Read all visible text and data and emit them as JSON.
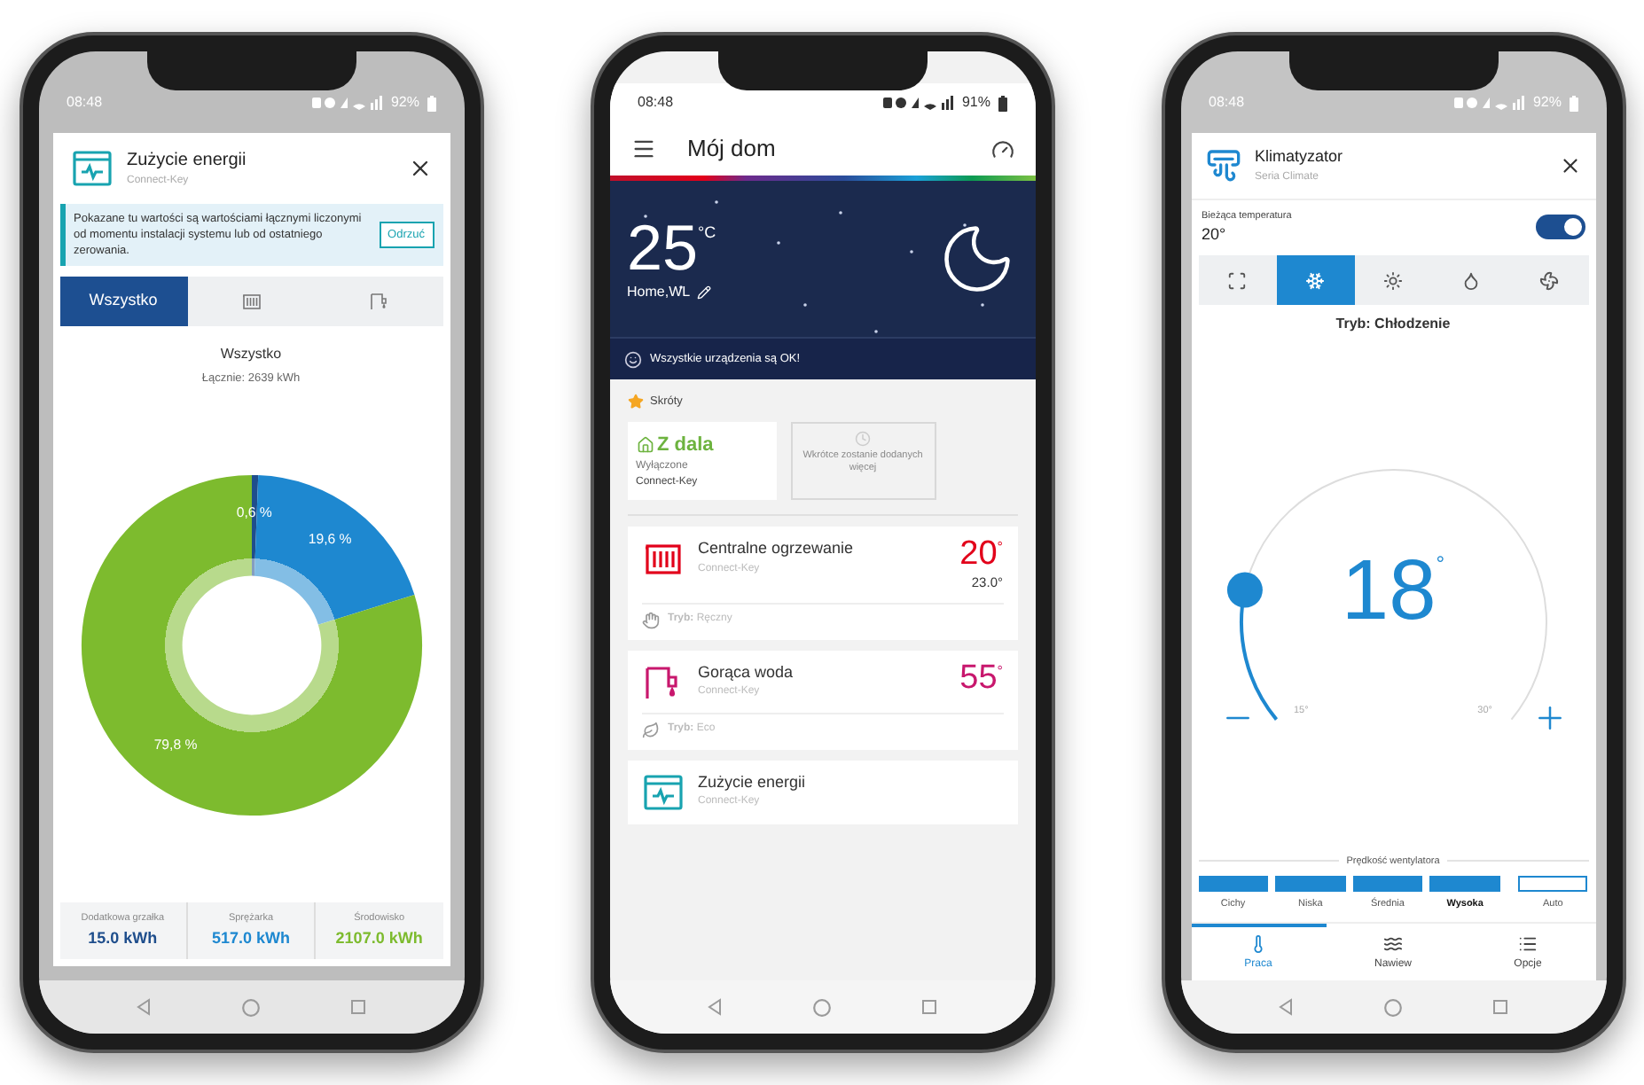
{
  "energy_screen": {
    "status_time": "08:48",
    "status_battery": "92%",
    "title": "Zużycie energii",
    "subtitle": "Connect-Key",
    "notice": "Pokazane tu wartości są wartościami łącznymi liczonymi od momentu instalacji systemu lub od ostatniego zerowania.",
    "dismiss": "Odrzuć",
    "tabs": [
      {
        "kind": "text",
        "label": "Wszystko",
        "selected": true
      },
      {
        "kind": "radiator",
        "selected": false
      },
      {
        "kind": "faucet",
        "selected": false
      }
    ],
    "chart_title": "Wszystko",
    "total": "Łącznie: 2639 kWh",
    "chart_data": {
      "type": "donut",
      "categories": [
        "Dodatkowa grzałka",
        "Sprężarka",
        "Środowisko"
      ],
      "values": [
        0.6,
        19.6,
        79.8
      ],
      "value_labels": [
        "0,6 %",
        "19,6 %",
        "79,8 %"
      ]
    },
    "stats": [
      {
        "value": "15.0 kWh",
        "color": "#1f4e8c"
      },
      {
        "value": "517.0 kWh",
        "color": "#1e88d0"
      },
      {
        "value": "2107.0 kWh",
        "color": "#7dbb2e"
      }
    ]
  },
  "home_screen": {
    "status_time": "08:48",
    "status_battery": "91%",
    "title": "Mój dom",
    "temperature": "25",
    "unit": "°C",
    "location": "Home,WL",
    "status": "Wszystkie urządzenia są OK!",
    "shortcuts_title": "Skróty",
    "shortcut": {
      "title": "Z dala",
      "state": "Wyłączone",
      "device": "Connect-Key"
    },
    "more_placeholder": "Wkrótce zostanie dodanych więcej",
    "devices": [
      {
        "kind": "radiator",
        "name": "Centralne ogrzewanie",
        "source": "Connect-Key",
        "value": "20",
        "unit": "°",
        "actual": "23.0°",
        "mode": {
          "kind": "hand",
          "text": "**Tryb:** Ręczny"
        },
        "color": "#e2001a"
      },
      {
        "kind": "faucet",
        "name": "Gorąca woda",
        "source": "Connect-Key",
        "value": "55",
        "unit": "°",
        "mode": {
          "kind": "leaf",
          "text": "**Tryb:** Eco"
        },
        "color": "#c8176d"
      },
      {
        "kind": "energy",
        "name": "Zużycie energii",
        "source": "Connect-Key",
        "color": "#18a3b0"
      }
    ]
  },
  "climate_screen": {
    "status_time": "08:48",
    "status_battery": "92%",
    "title": "Klimatyzator",
    "subtitle": "Seria Climate",
    "current_label": "Bieżąca temperatura",
    "current_value": "20°",
    "power_on": true,
    "modes": [
      {
        "kind": "auto",
        "selected": false
      },
      {
        "kind": "cool",
        "selected": true
      },
      {
        "kind": "heat",
        "selected": false
      },
      {
        "kind": "dry",
        "selected": false
      },
      {
        "kind": "fan",
        "selected": false
      }
    ],
    "mode_text": "Tryb: Chłodzenie",
    "setpoint": "18",
    "setpoint_unit": "°",
    "dial": {
      "min": "15°",
      "max": "30°"
    },
    "fan_title": "Prędkość wentylatora",
    "fan_speeds": [
      {
        "label": "Cichy",
        "on": true,
        "selected": false
      },
      {
        "label": "Niska",
        "on": true,
        "selected": false
      },
      {
        "label": "Średnia",
        "on": true,
        "selected": false
      },
      {
        "label": "Wysoka",
        "on": true,
        "selected": true
      },
      {
        "label": "Auto",
        "on": false,
        "selected": false
      }
    ],
    "nav": [
      {
        "kind": "thermometer",
        "label": "Praca",
        "selected": true
      },
      {
        "kind": "waves",
        "label": "Nawiew",
        "selected": false
      },
      {
        "kind": "list",
        "label": "Opcje",
        "selected": false
      }
    ]
  }
}
